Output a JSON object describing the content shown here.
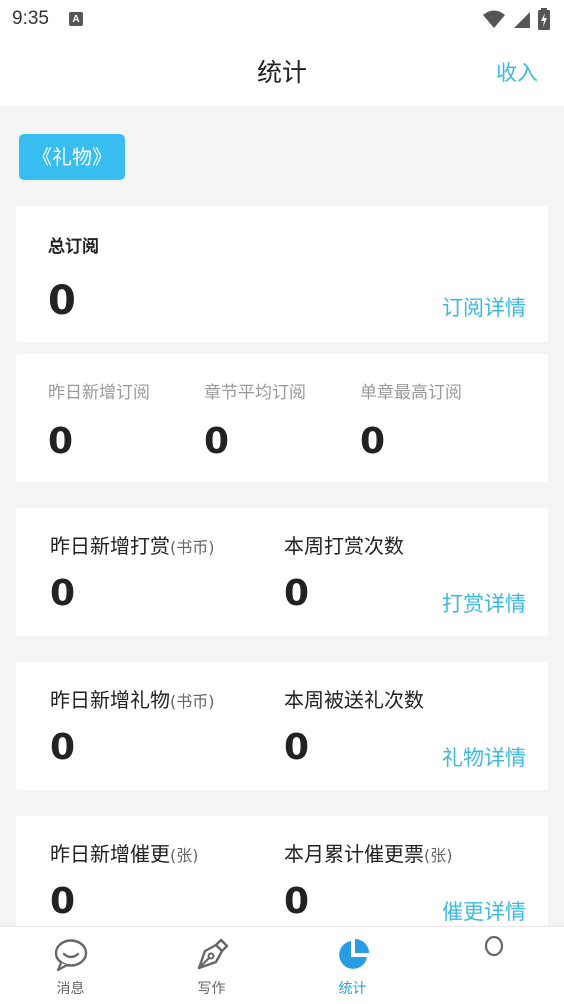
{
  "status_bar": {
    "time": "9:35",
    "notification_icon_letter": "A"
  },
  "header": {
    "title": "统计",
    "action": "收入"
  },
  "book_tag": "《礼物》",
  "total": {
    "label": "总订阅",
    "value": "0",
    "detail": "订阅详情"
  },
  "sub_stats": [
    {
      "label": "昨日新增订阅",
      "value": "0"
    },
    {
      "label": "章节平均订阅",
      "value": "0"
    },
    {
      "label": "单章最高订阅",
      "value": "0"
    }
  ],
  "reward": {
    "left": {
      "label": "昨日新增打赏",
      "unit": "(书币)",
      "value": "0"
    },
    "right": {
      "label": "本周打赏次数",
      "unit": "",
      "value": "0"
    },
    "detail": "打赏详情"
  },
  "gift": {
    "left": {
      "label": "昨日新增礼物",
      "unit": "(书币)",
      "value": "0"
    },
    "right": {
      "label": "本周被送礼次数",
      "unit": "",
      "value": "0"
    },
    "detail": "礼物详情"
  },
  "urge": {
    "left": {
      "label": "昨日新增催更",
      "unit": "(张)",
      "value": "0"
    },
    "right": {
      "label": "本月累计催更票",
      "unit": "(张)",
      "value": "0"
    },
    "detail": "催更详情"
  },
  "tabbar": [
    {
      "label": "消息",
      "icon": "chat-bubble-icon"
    },
    {
      "label": "写作",
      "icon": "pen-nib-icon"
    },
    {
      "label": "统计",
      "icon": "pie-chart-icon",
      "active": true
    },
    {
      "label": "",
      "icon": "profile-icon"
    }
  ],
  "colors": {
    "accent": "#3cb9e0",
    "tag_bg": "#38bdf0",
    "active_tab": "#2a9de2"
  }
}
